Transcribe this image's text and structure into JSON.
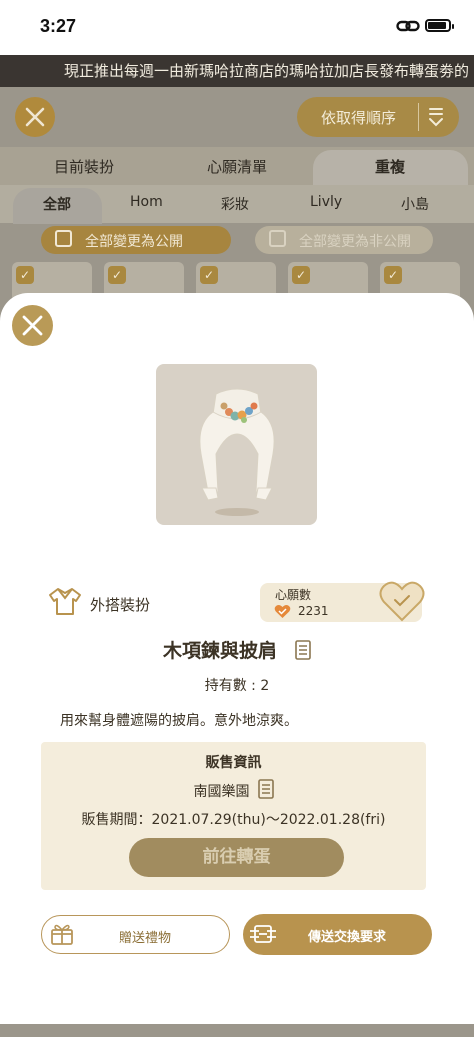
{
  "status_bar": {
    "time": "3:27"
  },
  "ticker": {
    "text": "現正推出每週一由新瑪哈拉商店的瑪哈拉加店長發布轉蛋劵的"
  },
  "background": {
    "sort_label": "依取得順序",
    "tabs": [
      "目前裝扮",
      "心願清單",
      "重複"
    ],
    "active_tab": "重複",
    "subtabs": [
      "全部",
      "Hom",
      "彩妝",
      "Livly",
      "小島"
    ],
    "active_subtab": "全部",
    "make_public": "全部變更為公開",
    "make_private": "全部變更為非公開"
  },
  "detail": {
    "category": "外搭裝扮",
    "wish_label": "心願數",
    "wish_count": "2231",
    "item_name": "木項鍊與披肩",
    "owned": "持有數 : 2",
    "description": "用來幫身體遮陽的披肩。意外地涼爽。",
    "sale": {
      "title": "販售資訊",
      "shop": "南國樂園",
      "period": "販售期間：2021.07.29(thu)～2022.01.28(fri)",
      "go_button": "前往轉蛋"
    },
    "gift_button": "贈送禮物",
    "trade_button": "傳送交換要求"
  },
  "colors": {
    "accent": "#b8934e",
    "sheet": "#ffffff",
    "info_bg": "#f4eddc"
  }
}
